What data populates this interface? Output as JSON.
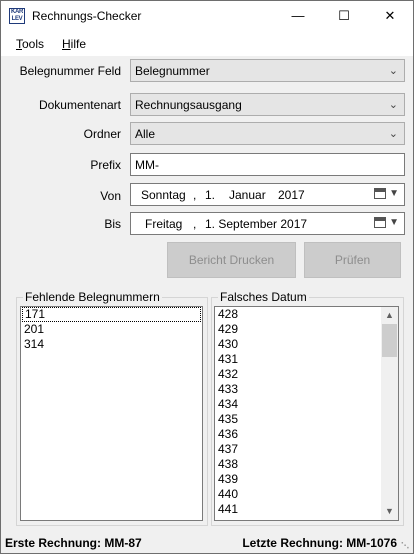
{
  "window": {
    "title": "Rechnungs-Checker",
    "icon_text_top": "KAR",
    "icon_text_bottom": "LEV",
    "minimize": "—",
    "maximize": "☐",
    "close": "✕"
  },
  "menu": {
    "tools": {
      "prefix": "",
      "accel": "T",
      "rest": "ools"
    },
    "help": {
      "prefix": "",
      "accel": "H",
      "rest": "ilfe"
    }
  },
  "form": {
    "belegnummer_feld": {
      "label": "Belegnummer Feld",
      "value": "Belegnummer"
    },
    "dokumentenart": {
      "label": "Dokumentenart",
      "value": "Rechnungsausgang"
    },
    "ordner": {
      "label": "Ordner",
      "value": "Alle"
    },
    "prefix": {
      "label": "Prefix",
      "value": "MM-"
    },
    "von": {
      "label": "Von",
      "weekday": "Sonntag",
      "day": "1.",
      "month": "Januar",
      "year": "2017"
    },
    "bis": {
      "label": "Bis",
      "weekday": "Freitag",
      "rest": "1. September 2017"
    },
    "comma": ","
  },
  "buttons": {
    "bericht_drucken": "Bericht Drucken",
    "pruefen": "Prüfen"
  },
  "fehlende": {
    "title": "Fehlende Belegnummern",
    "items": [
      "171",
      "201",
      "314"
    ]
  },
  "falsches": {
    "title": "Falsches Datum",
    "items": [
      "428",
      "429",
      "430",
      "431",
      "432",
      "433",
      "434",
      "435",
      "436",
      "437",
      "438",
      "439",
      "440",
      "441"
    ]
  },
  "status": {
    "erste": "Erste Rechnung: MM-87",
    "letzte": "Letzte Rechnung: MM-1076"
  }
}
